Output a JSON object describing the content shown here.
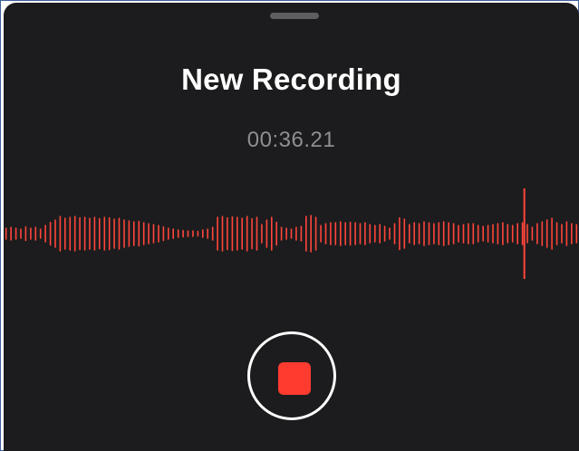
{
  "recording": {
    "title": "New Recording",
    "elapsed": "00:36.21"
  },
  "waveform": {
    "color": "#ff453a",
    "playhead_color": "#ff453a",
    "amplitudes": [
      0.12,
      0.14,
      0.12,
      0.1,
      0.15,
      0.12,
      0.14,
      0.1,
      0.18,
      0.25,
      0.3,
      0.38,
      0.34,
      0.36,
      0.38,
      0.35,
      0.36,
      0.34,
      0.36,
      0.33,
      0.36,
      0.35,
      0.32,
      0.34,
      0.3,
      0.28,
      0.26,
      0.27,
      0.24,
      0.22,
      0.2,
      0.18,
      0.15,
      0.12,
      0.1,
      0.08,
      0.07,
      0.06,
      0.06,
      0.05,
      0.08,
      0.1,
      0.14,
      0.36,
      0.38,
      0.35,
      0.37,
      0.36,
      0.34,
      0.38,
      0.33,
      0.36,
      0.2,
      0.3,
      0.36,
      0.25,
      0.14,
      0.12,
      0.1,
      0.14,
      0.16,
      0.38,
      0.4,
      0.36,
      0.18,
      0.22,
      0.24,
      0.24,
      0.26,
      0.24,
      0.25,
      0.24,
      0.22,
      0.24,
      0.2,
      0.18,
      0.2,
      0.16,
      0.12,
      0.22,
      0.35,
      0.32,
      0.2,
      0.24,
      0.22,
      0.26,
      0.24,
      0.22,
      0.24,
      0.26,
      0.24,
      0.22,
      0.18,
      0.2,
      0.22,
      0.22,
      0.18,
      0.16,
      0.18,
      0.2,
      0.22,
      0.24,
      0.2,
      0.18,
      0.22,
      0.24,
      0.2,
      0.14,
      0.22,
      0.26,
      0.3,
      0.34,
      0.24,
      0.2,
      0.26,
      0.22,
      0.2
    ],
    "playhead_fraction": 0.905
  },
  "controls": {
    "stop_color": "#ff3b30"
  }
}
